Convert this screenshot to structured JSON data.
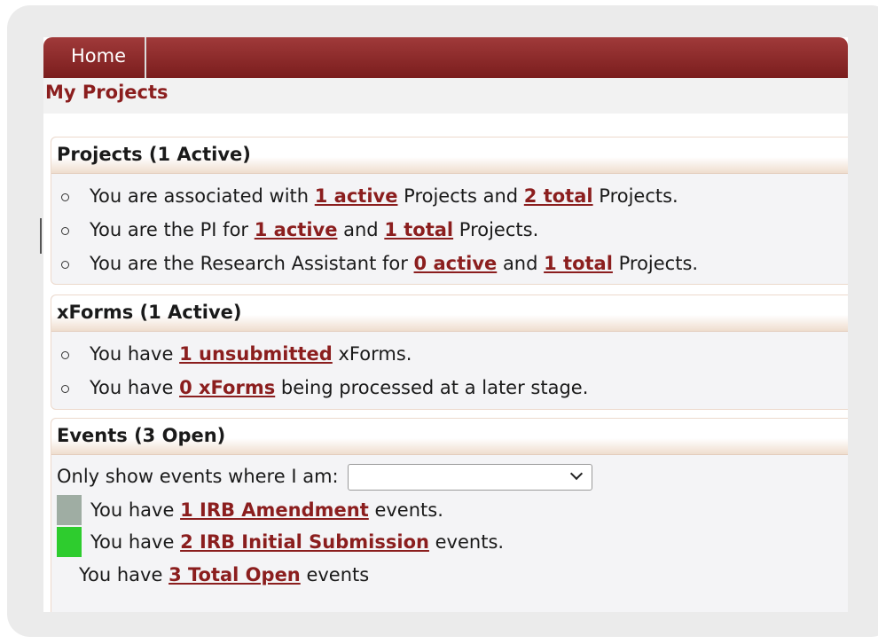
{
  "nav": {
    "home_label": "Home"
  },
  "page_title": "My Projects",
  "projects": {
    "header": "Projects (1 Active)",
    "items": [
      {
        "pre": "You are associated with ",
        "link1": "1 active",
        "mid": " Projects and ",
        "link2": "2 total",
        "post": " Projects."
      },
      {
        "pre": "You are the PI for ",
        "link1": "1 active",
        "mid": " and ",
        "link2": "1 total",
        "post": " Projects."
      },
      {
        "pre": "You are the Research Assistant for ",
        "link1": "0 active",
        "mid": " and ",
        "link2": "1 total",
        "post": " Projects."
      }
    ]
  },
  "xforms": {
    "header": "xForms (1 Active)",
    "items": [
      {
        "pre": "You have ",
        "link": "1 unsubmitted",
        "post": " xForms."
      },
      {
        "pre": "You have ",
        "link": "0 xForms",
        "post": " being processed at a later stage."
      }
    ]
  },
  "events": {
    "header": "Events (3 Open)",
    "filter_label": "Only show events where I am:",
    "filter_value": "",
    "rows": [
      {
        "pre": "You have ",
        "link": "1 IRB Amendment",
        "post": " events.",
        "color": "#9fada3"
      },
      {
        "pre": "You have ",
        "link": "2 IRB Initial Submission",
        "post": " events.",
        "color": "#2ecc2e"
      }
    ],
    "total": {
      "pre": "You have ",
      "link": "3 Total Open",
      "post": " events"
    }
  },
  "colors": {
    "accent": "#8b1e1e",
    "nav_bg": "#7a1d1d"
  }
}
